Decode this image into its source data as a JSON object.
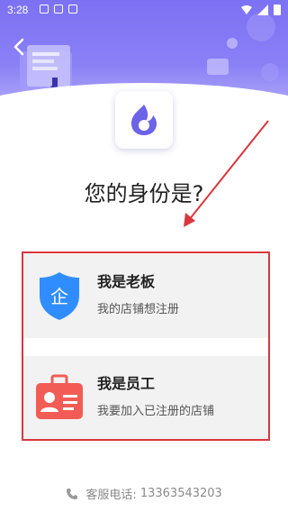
{
  "status_bar": {
    "time": "3:28"
  },
  "header": {
    "back_icon": "chevron-left-icon"
  },
  "logo": {
    "icon": "app-logo-icon"
  },
  "question": "您的身份是?",
  "options": [
    {
      "title": "我是老板",
      "desc": "我的店铺想注册",
      "icon": "enterprise-shield-icon"
    },
    {
      "title": "我是员工",
      "desc": "我要加入已注册的店铺",
      "icon": "id-badge-icon"
    }
  ],
  "footer": {
    "phone_label": "客服电话:",
    "phone_number": "13363543203"
  },
  "colors": {
    "accent": "#7b71f3",
    "annotation_red": "#d9363e",
    "shield_blue": "#2f8dff",
    "badge_red": "#f25c54"
  }
}
